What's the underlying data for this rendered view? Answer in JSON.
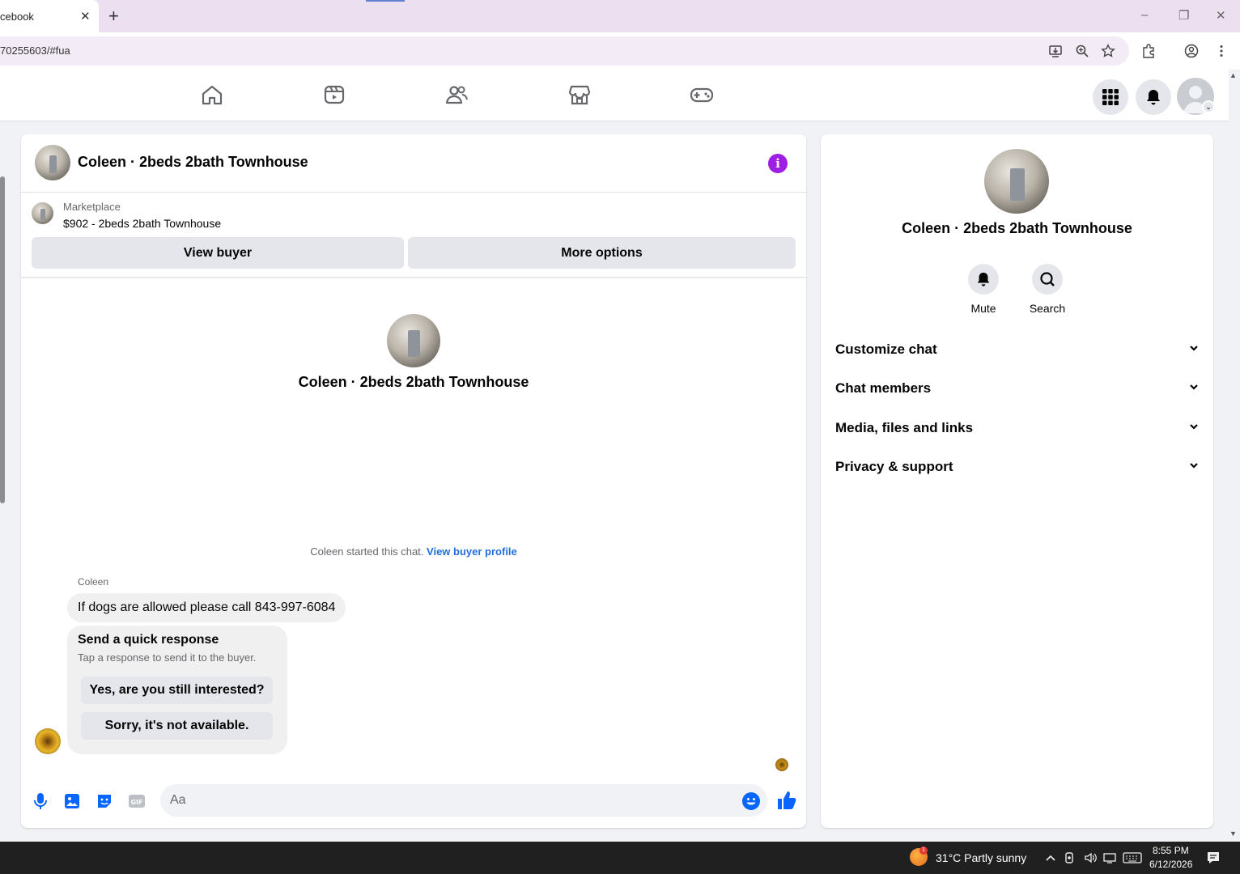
{
  "browser": {
    "tab_title": "cebook",
    "tab_close": "✕",
    "new_tab": "+",
    "url": "70255603/#fua",
    "window_controls": [
      "–",
      "❐",
      "✕"
    ]
  },
  "nav": {
    "icons": [
      "home-icon",
      "video-icon",
      "friends-icon",
      "marketplace-icon",
      "gaming-icon"
    ]
  },
  "chat": {
    "title": "Coleen · 2beds 2bath Townhouse",
    "marketplace_label": "Marketplace",
    "listing": "$902 - 2beds 2bath Townhouse",
    "view_buyer": "View buyer",
    "more_options": "More options",
    "center_name": "Coleen · 2beds 2bath Townhouse",
    "started_text": "Coleen started this chat. ",
    "view_buyer_profile": "View buyer profile",
    "sender": "Coleen",
    "message": "If dogs are allowed please call 843-997-6084",
    "quick_title": "Send a quick response",
    "quick_sub": "Tap a response to send it to the buyer.",
    "quick_1": "Yes, are you still interested?",
    "quick_2": "Sorry, it's not available.",
    "composer_placeholder": "Aa",
    "accent": "#0866ff"
  },
  "side": {
    "name": "Coleen · 2beds 2bath Townhouse",
    "mute": "Mute",
    "search": "Search",
    "sections": [
      "Customize chat",
      "Chat members",
      "Media, files and links",
      "Privacy & support"
    ]
  },
  "taskbar": {
    "weather": "31°C  Partly sunny",
    "weather_badge": "1",
    "time": "8:55 PM",
    "date": "6/12/2026"
  }
}
